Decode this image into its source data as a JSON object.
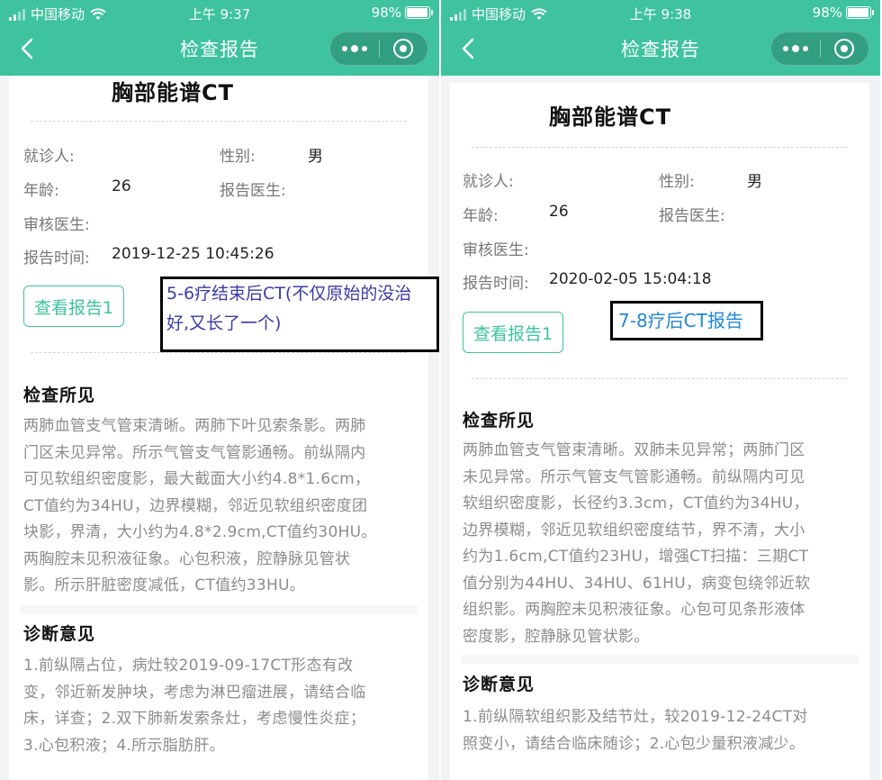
{
  "screens": [
    {
      "status": {
        "carrier": "中国移动",
        "time": "上午 9:37",
        "battery": "98%",
        "battery_level": 0.98
      },
      "nav": {
        "title": "检查报告"
      },
      "report": {
        "title": "胸部能谱CT",
        "patient_label": "就诊人:",
        "patient_value": "",
        "gender_label": "性别:",
        "gender_value": "男",
        "age_label": "年龄:",
        "age_value": "26",
        "doctor_label": "报告医生:",
        "doctor_value": "",
        "reviewer_label": "审核医生:",
        "reviewer_value": "",
        "time_label": "报告时间:",
        "time_value": "2019-12-25 10:45:26",
        "view_button": "查看报告1",
        "annotation_line1": "5-6疗结束后CT(不仅原始的没治",
        "annotation_line2": "好,又长了一个)",
        "findings_title": "检查所见",
        "findings_lines": [
          "两肺血管支气管束清晰。两肺下叶见索条影。两肺",
          "门区未见异常。所示气管支气管影通畅。前纵隔内",
          "可见软组织密度影，最大截面大小约4.8*1.6cm，",
          "CT值约为34HU，边界模糊，邻近见软组织密度团",
          "块影，界清，大小约为4.8*2.9cm,CT值约30HU。",
          "两胸腔未见积液征象。心包积液，腔静脉见管状",
          "影。所示肝脏密度减低，CT值约33HU。"
        ],
        "diagnosis_title": "诊断意见",
        "diagnosis_lines": [
          "1.前纵隔占位，病灶较2019-09-17CT形态有改",
          "变，邻近新发肿块，考虑为淋巴瘤进展，请结合临",
          "床，详查；2.双下肺新发索条灶，考虑慢性炎症；",
          "3.心包积液；4.所示脂肪肝。"
        ]
      }
    },
    {
      "status": {
        "carrier": "中国移动",
        "time": "上午 9:38",
        "battery": "98%",
        "battery_level": 0.98
      },
      "nav": {
        "title": "检查报告"
      },
      "report": {
        "title": "胸部能谱CT",
        "patient_label": "就诊人:",
        "patient_value": "",
        "gender_label": "性别:",
        "gender_value": "男",
        "age_label": "年龄:",
        "age_value": "26",
        "doctor_label": "报告医生:",
        "doctor_value": "",
        "reviewer_label": "审核医生:",
        "reviewer_value": "",
        "time_label": "报告时间:",
        "time_value": "2020-02-05 15:04:18",
        "view_button": "查看报告1",
        "annotation_line1": "7-8疗后CT报告",
        "findings_title": "检查所见",
        "findings_lines": [
          "两肺血管支气管束清晰。双肺未见异常；两肺门区",
          "未见异常。所示气管支气管影通畅。前纵隔内可见",
          "软组织密度影，长径约3.3cm，CT值约为34HU，",
          "边界模糊，邻近见软组织密度结节，界不清，大小",
          "约为1.6cm,CT值约23HU，增强CT扫描：三期CT",
          "值分别为44HU、34HU、61HU，病变包绕邻近软",
          "组织影。两胸腔未见积液征象。心包可见条形液体",
          "密度影，腔静脉见管状影。"
        ],
        "diagnosis_title": "诊断意见",
        "diagnosis_lines": [
          "1.前纵隔软组织影及结节灶，较2019-12-24CT对",
          "照变小，请结合临床随诊；2.心包少量积液减少。"
        ]
      }
    }
  ]
}
